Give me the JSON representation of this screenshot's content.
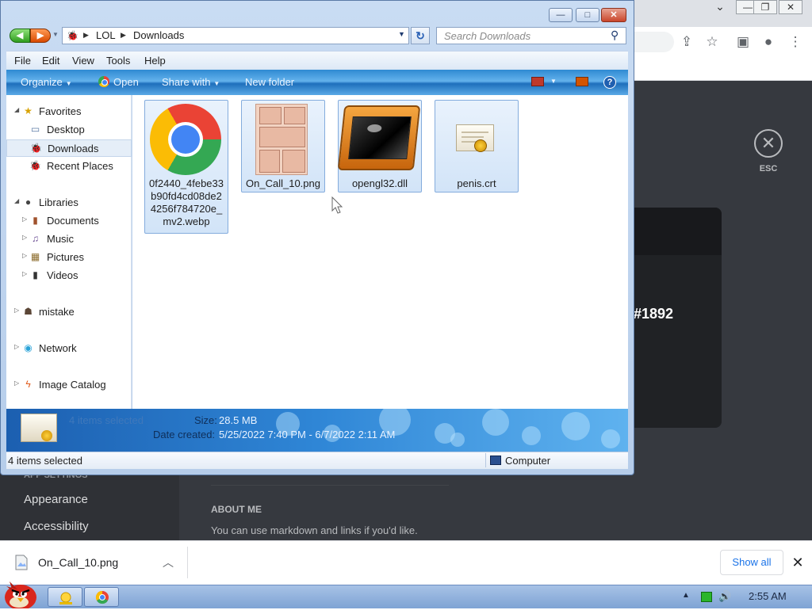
{
  "chrome": {
    "minimize_label": "—",
    "restore_label": "❐",
    "close_label": "✕",
    "dropdown_label": "⌄",
    "share_icon": "share-icon",
    "star_icon": "star-icon",
    "sidepanel_icon": "sidepanel-icon",
    "profile_icon": "profile-icon",
    "menu_icon": "kebab-menu-icon"
  },
  "discord": {
    "esc_symbol": "✕",
    "esc_label": "ESC",
    "user_tag": "#1892",
    "app_settings_header": "APP SETTINGS",
    "side_items": [
      "Appearance",
      "Accessibility"
    ],
    "about_me_label": "ABOUT ME",
    "about_me_hint": "You can use markdown and links if you'd like."
  },
  "explorer": {
    "window_controls": {
      "minimize": "—",
      "maximize": "□",
      "close": "✕"
    },
    "nav_back": "◀",
    "nav_forward": "▶",
    "breadcrumb": [
      "LOL",
      "Downloads"
    ],
    "search_placeholder": "Search Downloads",
    "menu": [
      "File",
      "Edit",
      "View",
      "Tools",
      "Help"
    ],
    "commands": {
      "organize": "Organize",
      "open": "Open",
      "share_with": "Share with",
      "new_folder": "New folder",
      "help": "?"
    },
    "nav_pane": {
      "favorites": "Favorites",
      "desktop": "Desktop",
      "downloads": "Downloads",
      "recent_places": "Recent Places",
      "libraries": "Libraries",
      "documents": "Documents",
      "music": "Music",
      "pictures": "Pictures",
      "videos": "Videos",
      "mistake": "mistake",
      "network": "Network",
      "image_catalog": "Image Catalog"
    },
    "files": [
      {
        "name": "0f2440_4febe33b90fd4cd08de24256f784720e_mv2.webp",
        "icon": "chrome-icon",
        "selected": true
      },
      {
        "name": "On_Call_10.png",
        "icon": "comic-thumbnail-icon",
        "selected": true
      },
      {
        "name": "opengl32.dll",
        "icon": "dll-file-icon",
        "selected": true
      },
      {
        "name": "penis.crt",
        "icon": "certificate-icon",
        "selected": true
      }
    ],
    "details": {
      "count_text": "4 items selected",
      "size_label": "Size:",
      "size_value": "28.5 MB",
      "date_label": "Date created:",
      "date_value": "5/25/2022 7:40 PM - 6/7/2022 2:11 AM"
    },
    "status": {
      "left": "4 items selected",
      "right": "Computer"
    }
  },
  "download_bar": {
    "file_name": "On_Call_10.png",
    "show_all": "Show all",
    "close": "✕"
  },
  "taskbar": {
    "time": "2:55 AM"
  }
}
